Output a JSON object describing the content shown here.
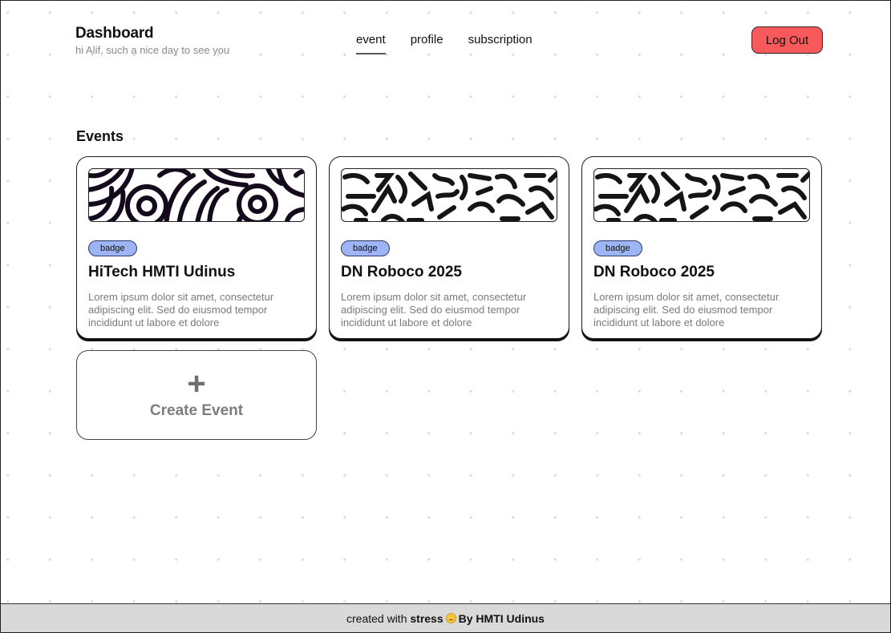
{
  "header": {
    "title": "Dashboard",
    "greeting": "hi Alif, such a nice day to see you",
    "nav": [
      {
        "label": "event",
        "active": true
      },
      {
        "label": "profile",
        "active": false
      },
      {
        "label": "subscription",
        "active": false
      }
    ],
    "logout_label": "Log Out",
    "logout_color": "#f8595a"
  },
  "events": {
    "section_title": "Events",
    "cards": [
      {
        "badge": "badge",
        "title": "HiTech HMTI Udinus",
        "description": "Lorem ipsum dolor sit amet, consectetur adipiscing elit. Sed do eiusmod tempor incididunt ut labore et dolore",
        "banner_pattern": "swirls"
      },
      {
        "badge": "badge",
        "title": "DN Roboco 2025",
        "description": "Lorem ipsum dolor sit amet, consectetur adipiscing elit. Sed do eiusmod tempor incididunt ut labore et dolore",
        "banner_pattern": "squiggles"
      },
      {
        "badge": "badge",
        "title": "DN Roboco 2025",
        "description": "Lorem ipsum dolor sit amet, consectetur adipiscing elit. Sed do eiusmod tempor incididunt ut labore et dolore",
        "banner_pattern": "squiggles"
      }
    ],
    "create_icon": "plus-icon",
    "create_label": "Create Event"
  },
  "footer": {
    "prefix": "created with",
    "stress": "stress",
    "emoji_icon": "expressionless-face-icon",
    "suffix": "By HMTI Udinus"
  },
  "colors": {
    "badge": "#9db4f5",
    "logout": "#f8595a",
    "footer": "#d9d9d9"
  }
}
